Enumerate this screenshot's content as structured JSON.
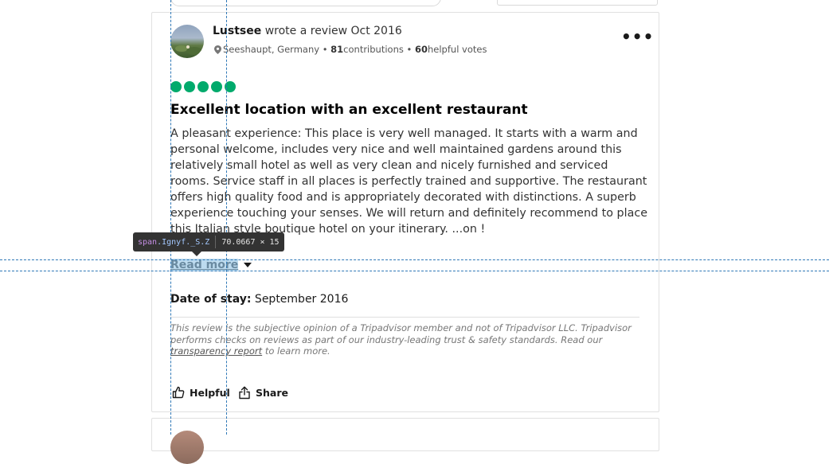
{
  "review": {
    "author": "Lustsee",
    "action_text": " wrote a review Oct 2016",
    "location": "Seeshaupt, Germany",
    "contributions_count": "81",
    "contributions_label": " contributions",
    "votes_count": "60",
    "votes_label": " helpful votes",
    "rating": 5,
    "title": "Excellent location with an excellent restaurant",
    "body": "A pleasant experience: This place is very well managed. It starts with a warm and personal welcome, includes very nice and well maintained gardens around this relatively small hotel as well as very clean and nicely furnished and serviced rooms. Service staff in all places is perfectly trained and supportive. The restaurant offers high quality food and is appropriately decorated with distinctions. A superb experience touching your senses. We will return and definitely recommend to place this Italian style boutique hotel on your itinerary. ...on !",
    "read_more_label": "Read more",
    "date_of_stay_label": "Date of stay:",
    "date_of_stay_value": " September 2016",
    "disclaimer_pre": "This review is the subjective opinion of a Tripadvisor member and not of Tripadvisor LLC. Tripadvisor performs checks on reviews as part of our industry-leading trust & safety standards. Read our ",
    "disclaimer_link": "transparency report",
    "disclaimer_post": " to learn more.",
    "helpful_label": "Helpful",
    "share_label": "Share",
    "menu_glyph": "•••",
    "pin_glyph": "⚲"
  },
  "devtools": {
    "tag": "span",
    "class_name": ".Ignyf._S.Z",
    "dimensions": "70.0667 × 15"
  },
  "colors": {
    "rating_bubble": "#00aa6c",
    "guide_line": "#2f78b7",
    "highlight": "#87bee1"
  },
  "icons": {
    "helpful": "thumbs-up-icon",
    "share": "share-icon",
    "location": "map-pin-icon",
    "menu": "more-options-icon",
    "expand": "caret-down-icon"
  }
}
